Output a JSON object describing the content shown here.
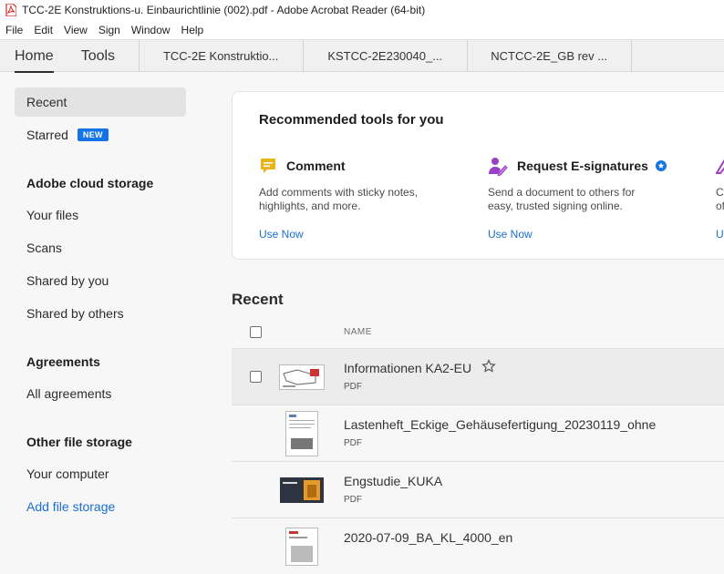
{
  "window": {
    "title": "TCC-2E Konstruktions-u. Einbaurichtlinie (002).pdf - Adobe Acrobat Reader (64-bit)",
    "app_icon": "acrobat-pdf-icon"
  },
  "menu": [
    "File",
    "Edit",
    "View",
    "Sign",
    "Window",
    "Help"
  ],
  "tabs": {
    "home": "Home",
    "tools": "Tools",
    "documents": [
      "TCC-2E Konstruktio...",
      "KSTCC-2E230040_...",
      "NCTCC-2E_GB rev ..."
    ]
  },
  "sidebar": {
    "recent": "Recent",
    "starred": "Starred",
    "new_badge": "NEW",
    "cloud_heading": "Adobe cloud storage",
    "your_files": "Your files",
    "scans": "Scans",
    "shared_by_you": "Shared by you",
    "shared_by_others": "Shared by others",
    "agreements_heading": "Agreements",
    "all_agreements": "All agreements",
    "other_heading": "Other file storage",
    "your_computer": "Your computer",
    "add_file_storage": "Add file storage"
  },
  "recommended": {
    "title": "Recommended tools for you",
    "tools": [
      {
        "name": "Comment",
        "icon": "comment-icon",
        "desc_line1": "Add comments with sticky notes,",
        "desc_line2": "highlights, and more.",
        "link": "Use Now"
      },
      {
        "name": "Request E-signatures",
        "icon": "esign-icon",
        "desc_line1": "Send a document to others for",
        "desc_line2": "easy, trusted signing online.",
        "link": "Use Now"
      },
      {
        "name": "",
        "icon": "edit-icon",
        "desc_line1": "C",
        "desc_line2": "of",
        "link": "U"
      }
    ]
  },
  "recent": {
    "title": "Recent",
    "name_header": "NAME",
    "files": [
      {
        "name": "Informationen KA2-EU",
        "type": "PDF",
        "starrable": true
      },
      {
        "name": "Lastenheft_Eckige_Gehäusefertigung_20230119_ohne",
        "type": "PDF"
      },
      {
        "name": "Engstudie_KUKA",
        "type": "PDF"
      },
      {
        "name": "2020-07-09_BA_KL_4000_en",
        "type": ""
      }
    ]
  },
  "colors": {
    "accent_blue": "#1473e6",
    "link_blue": "#1a6fd1",
    "comment_yellow": "#e8b517",
    "esign_purple": "#9b3fc9"
  }
}
